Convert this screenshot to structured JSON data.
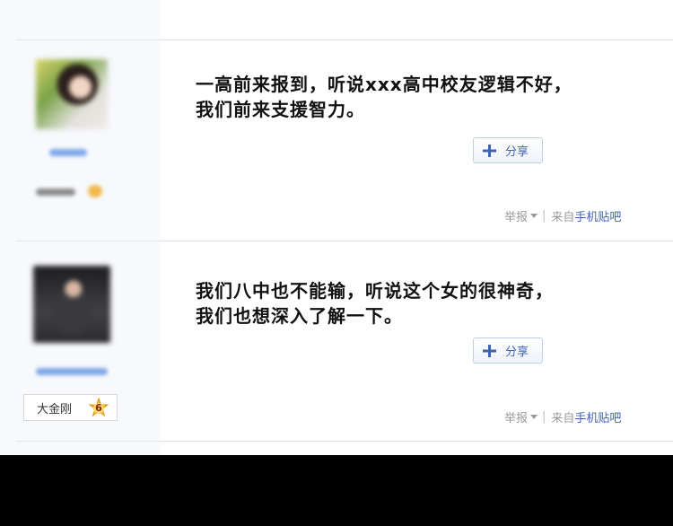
{
  "posts": [
    {
      "author_name_blurred": true,
      "rank_blurred": true,
      "content_lines": [
        "一高前来报到，听说xxx高中校友逻辑不好，",
        "我们前来支援智力。"
      ],
      "share_label": "分享",
      "report_label": "举报",
      "separator": "|",
      "from_label": "来自",
      "source_label": "手机贴吧"
    },
    {
      "author_name_blurred": true,
      "rank_label": "大金刚",
      "rank_level": "6",
      "content_lines": [
        "我们八中也不能输，听说这个女的很神奇，",
        "我们也想深入了解一下。"
      ],
      "share_label": "分享",
      "report_label": "举报",
      "separator": "|",
      "from_label": "来自",
      "source_label": "手机贴吧"
    }
  ],
  "colors": {
    "link_blue": "#3f63b2",
    "meta_gray": "#999999",
    "sidebar_bg": "#f7f9fc",
    "bottom_bar": "#000000"
  }
}
